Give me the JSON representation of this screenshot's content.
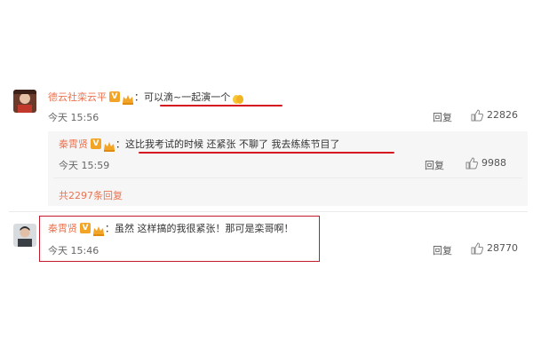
{
  "comments": [
    {
      "user": "德云社栾云平",
      "separator": "：",
      "text": "可以滴~一起演一个",
      "time": "今天 15:56",
      "reply_label": "回复",
      "likes": "22826"
    },
    {
      "user": "秦霄贤",
      "separator": "：",
      "text": "这比我考试的时候 还紧张   不聊了  我去练练节目了",
      "time": "今天 15:59",
      "reply_label": "回复",
      "likes": "9988"
    },
    {
      "user": "秦霄贤",
      "separator": "：",
      "text": "虽然 这样搞的我很紧张！那可是栾哥啊！",
      "time": "今天 15:46",
      "reply_label": "回复",
      "likes": "28770"
    }
  ],
  "more_replies": "共2297条回复",
  "badges": {
    "verified": "V"
  },
  "colors": {
    "username": "#eb7350",
    "badge": "#f2a427",
    "highlight_red": "#d4141f",
    "reply_bg": "#f6f6f6"
  },
  "icons": [
    "avatar",
    "verified-badge-icon",
    "crown-badge-icon",
    "thumbs-up-icon",
    "emoji-clap-icon"
  ]
}
